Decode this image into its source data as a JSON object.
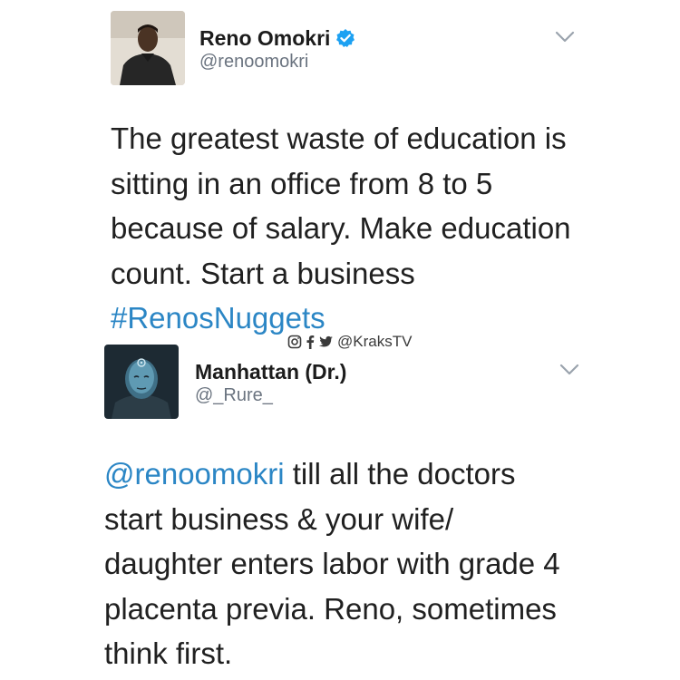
{
  "tweet1": {
    "name": "Reno Omokri",
    "handle": "@renoomokri",
    "text_lines": [
      "The greatest waste of education is",
      "sitting in an office from 8 to 5",
      "because of salary. Make education",
      "count. Start a business"
    ],
    "hashtag": "#RenosNuggets",
    "avatar_icon": "profile-photo-icon",
    "verified_icon": "verified-badge-icon",
    "menu_icon": "chevron-down-icon"
  },
  "watermark": {
    "icons": [
      "instagram-icon",
      "facebook-icon",
      "twitter-icon"
    ],
    "text": "@KraksTV"
  },
  "tweet2": {
    "name": "Manhattan (Dr.)",
    "handle": "@_Rure_",
    "mention": "@renoomokri",
    "text_first_rest": " till all the doctors",
    "text_lines": [
      "start business & your wife/",
      "daughter enters labor with grade 4",
      "placenta previa. Reno, sometimes",
      "think first."
    ],
    "avatar_icon": "profile-photo-icon",
    "menu_icon": "chevron-down-icon"
  },
  "colors": {
    "link": "#2b86c5",
    "verified": "#1da1f2",
    "handle": "#6b7480",
    "avatar2_bg": "#1d2a33"
  }
}
